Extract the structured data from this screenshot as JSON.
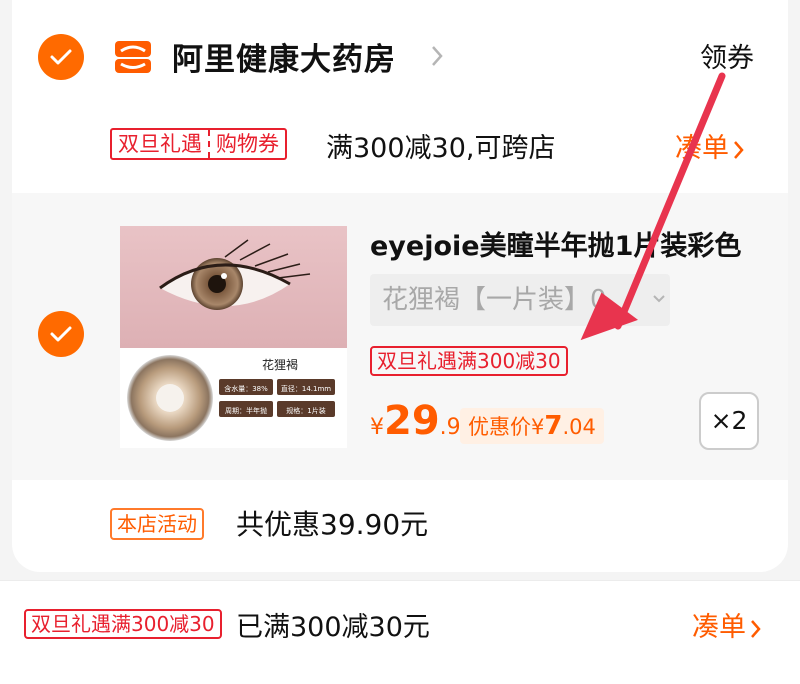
{
  "store": {
    "name": "阿里健康大药房",
    "coupon_label": "领券",
    "logo_icon": "store-logo-icon",
    "selected": true
  },
  "promo": {
    "tag_left": "双旦礼遇",
    "tag_right": "购物券",
    "text": "满300减30,可跨店",
    "link": "凑单"
  },
  "item": {
    "selected": true,
    "thumb_label": "花狸褐",
    "spec_tags": [
      "含水量：38%",
      "直径：14.1mm",
      "周期：半年抛",
      "规格：1片装"
    ],
    "title": "eyejoie美瞳半年抛1片装彩色",
    "sku": "花狸褐【一片装】0",
    "tag": "双旦礼遇满300减30",
    "price_currency": "¥",
    "price_int": "29",
    "price_dec": ".9",
    "promo_price_label": "优惠价¥",
    "promo_price_int": "7",
    "promo_price_dec": ".04",
    "quantity": "×2"
  },
  "shop_event": {
    "tag": "本店活动",
    "text": "共优惠39.90元"
  },
  "bottom": {
    "tag": "双旦礼遇满300减30",
    "text": "已满300减30元",
    "link": "凑单"
  },
  "colors": {
    "accent": "#ff6a00",
    "price": "#ff5c00",
    "tag_red": "#e8202e",
    "annotation_arrow": "#e8344e"
  }
}
